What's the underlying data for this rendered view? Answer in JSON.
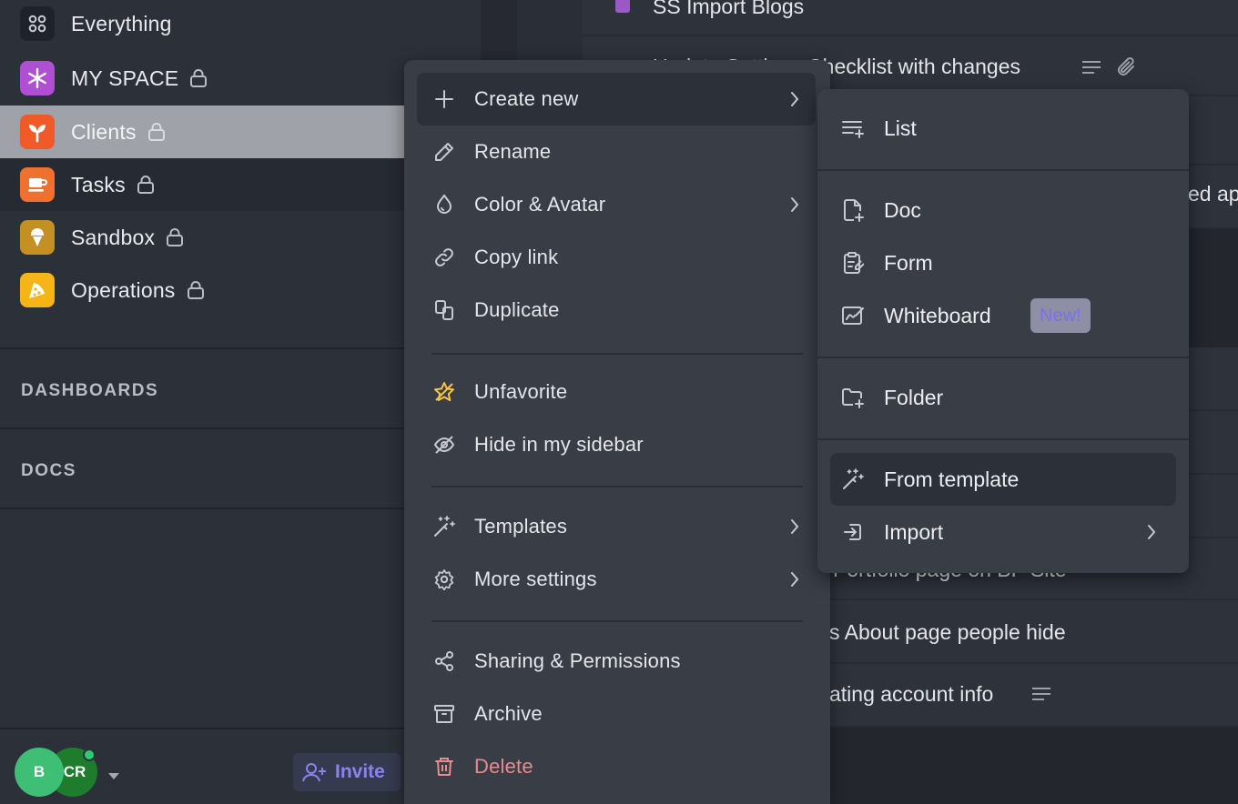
{
  "sidebar": {
    "spaces": [
      {
        "name": "Everything",
        "icon": "grid-icon",
        "color": "#1f222a",
        "locked": false
      },
      {
        "name": "MY SPACE",
        "icon": "snowflake-icon",
        "color": "#b04fd3",
        "locked": true
      },
      {
        "name": "Clients",
        "icon": "sprout-icon",
        "color": "#f05a28",
        "locked": true
      },
      {
        "name": "Tasks",
        "icon": "coffee-icon",
        "color": "#f07030",
        "locked": true
      },
      {
        "name": "Sandbox",
        "icon": "ice-cream-icon",
        "color": "#c59023",
        "locked": true
      },
      {
        "name": "Operations",
        "icon": "pizza-icon",
        "color": "#f5b517",
        "locked": true
      }
    ],
    "sections": {
      "dashboards": "DASHBOARDS",
      "docs": "DOCS"
    },
    "footer": {
      "avatar_b": "B",
      "avatar_cr": "CR",
      "invite_label": "Invite"
    }
  },
  "tasks": [
    {
      "text": "SS Import Blogs"
    },
    {
      "text": "Update Settings Checklist with changes"
    },
    {
      "text": "ed ap"
    },
    {
      "text": "Portfolio page on BP Site"
    },
    {
      "text": "s About page people hide"
    },
    {
      "text": "ating account info"
    }
  ],
  "context_menu": {
    "create_new": "Create new",
    "rename": "Rename",
    "color_avatar": "Color & Avatar",
    "copy_link": "Copy link",
    "duplicate": "Duplicate",
    "unfavorite": "Unfavorite",
    "hide_sidebar": "Hide in my sidebar",
    "templates": "Templates",
    "more_settings": "More settings",
    "sharing": "Sharing & Permissions",
    "archive": "Archive",
    "delete": "Delete"
  },
  "submenu": {
    "list": "List",
    "doc": "Doc",
    "form": "Form",
    "whiteboard": "Whiteboard",
    "whiteboard_badge": "New!",
    "folder": "Folder",
    "from_template": "From template",
    "import": "Import"
  },
  "colors": {
    "accent": "#7b6ff0",
    "delete": "#e98a8e",
    "favorite": "#f5c542",
    "online": "#2ecc71"
  }
}
